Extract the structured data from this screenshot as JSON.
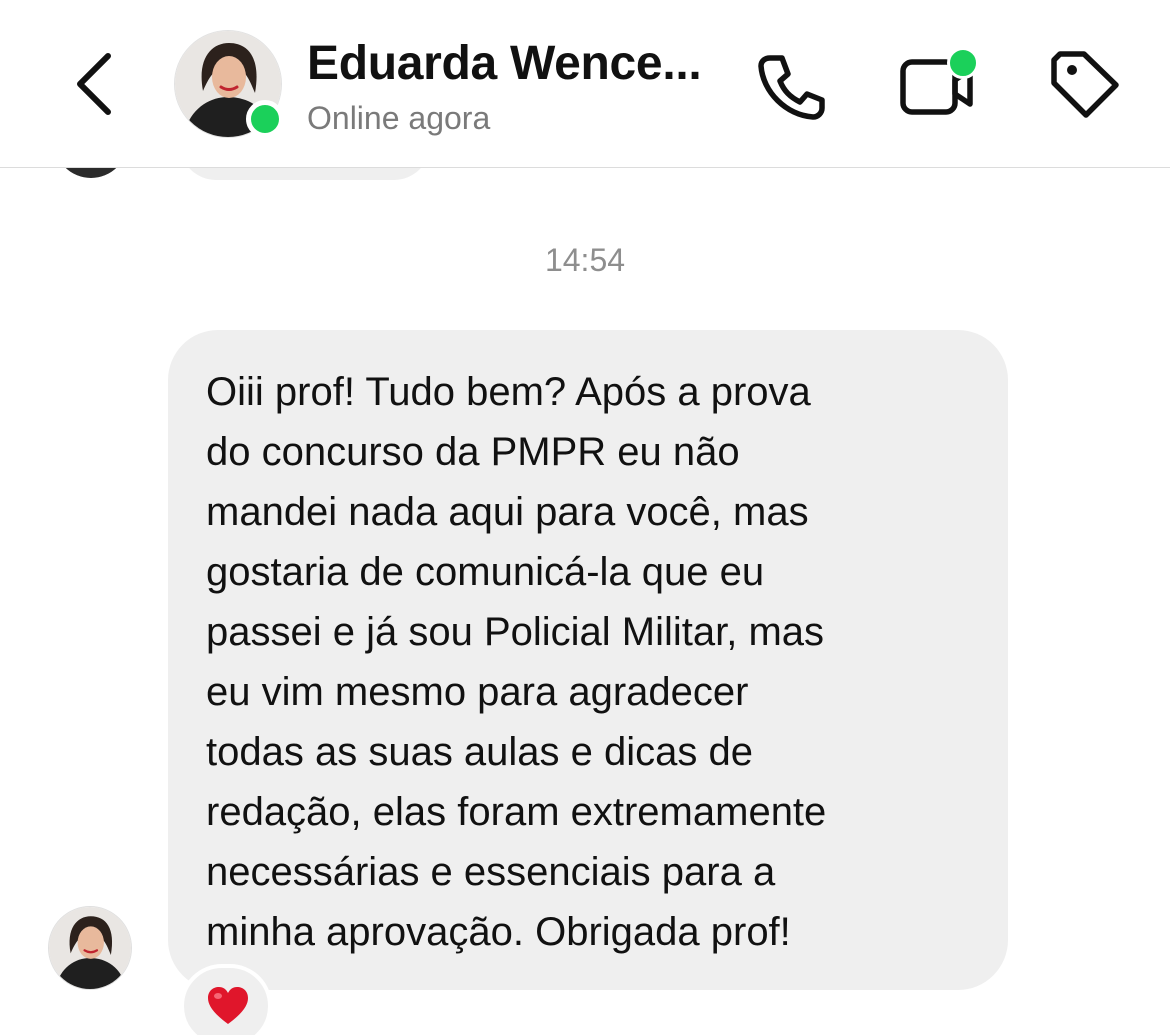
{
  "header": {
    "contact_name": "Eduarda Wence...",
    "status": "Online agora",
    "icons": {
      "back": "chevron-left-icon",
      "call": "phone-icon",
      "video": "video-camera-icon",
      "tag": "tag-icon"
    }
  },
  "chat": {
    "timestamp": "14:54",
    "message": {
      "text": "Oiii prof! Tudo bem? Após a prova\ndo concurso da PMPR eu não\nmandei nada aqui para você, mas\ngostaria de comunicá-la que eu\npassei e já sou Policial Militar, mas\neu vim mesmo para agradecer\ntodas as suas aulas e dicas de\nredação, elas foram extremamente\nnecessárias e essenciais para a\nminha aprovação. Obrigada prof!",
      "reaction": "heart-icon"
    }
  },
  "colors": {
    "online_green": "#1bd05a",
    "bubble_gray": "#efefef",
    "reaction_red": "#e0162b",
    "secondary_text": "#7a7a7a"
  }
}
